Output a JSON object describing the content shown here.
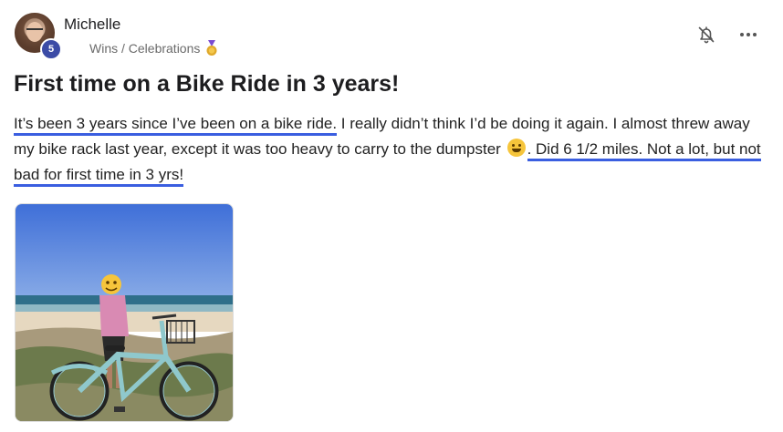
{
  "post": {
    "author": {
      "name": "Michelle",
      "level": "5",
      "avatar_icon": "user-avatar"
    },
    "category": {
      "label": "Wins / Celebrations",
      "icon": "medal-icon"
    },
    "actions": {
      "notify_icon": "bell-off-icon",
      "more_icon": "more-horizontal-icon"
    },
    "title": "First time on a Bike Ride in 3 years!",
    "body": {
      "highlight_1": "It’s been 3 years since I’ve been on a bike ride.",
      "text_1": " I really didn’t think I’d be doing it again. I almost threw away my bike rack last year, except it was too heavy to carry to the dumpster ",
      "emoji": "grinning-sweat-emoji",
      "highlight_2": ". Did 6 1/2 miles. Not a lot, but not bad for first time in 3 yrs!"
    },
    "attachment": {
      "type": "image",
      "subject": "beach-bike-photo"
    },
    "colors": {
      "highlight": "#3a5ee0",
      "badge": "#3b4ba6"
    }
  }
}
